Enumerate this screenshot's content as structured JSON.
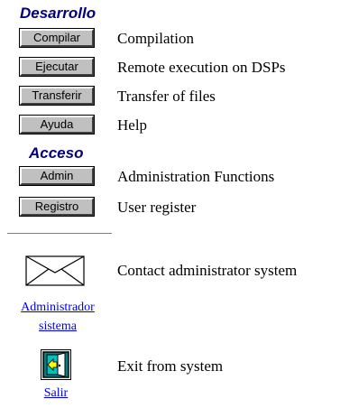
{
  "sections": {
    "development": "Desarrollo",
    "access": "Acceso"
  },
  "menu": [
    {
      "button": "Compilar",
      "description": "Compilation"
    },
    {
      "button": "Ejecutar",
      "description": "Remote execution on DSPs"
    },
    {
      "button": "Transferir",
      "description": "Transfer of files"
    },
    {
      "button": "Ayuda",
      "description": "Help"
    },
    {
      "button": "Admin",
      "description": "Administration Functions"
    },
    {
      "button": "Registro",
      "description": "User register"
    }
  ],
  "contact": {
    "icon": "envelope-icon",
    "link_line1": "Administrador",
    "link_line2": "sistema",
    "description": "Contact administrator system"
  },
  "exit": {
    "icon": "exit-door-icon",
    "link": "Salir",
    "description": "Exit from system"
  },
  "colors": {
    "heading": "#000080",
    "button_face": "#c0c0c0",
    "link": "#0000ee",
    "exit_icon_teal": "#008080"
  }
}
